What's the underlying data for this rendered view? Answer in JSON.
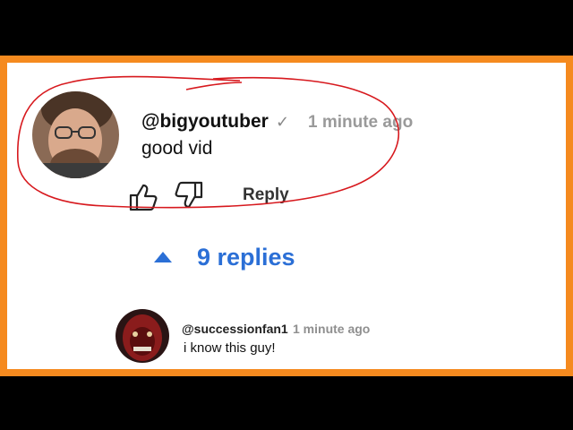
{
  "comment": {
    "username": "@bigyoutuber",
    "verified_icon": "✓",
    "timestamp": "1 minute ago",
    "text": "good vid",
    "like_icon": "thumbs-up-icon",
    "dislike_icon": "thumbs-down-icon",
    "reply_label": "Reply"
  },
  "replies_toggle": {
    "label": "9 replies",
    "icon": "caret-up-icon"
  },
  "first_reply": {
    "username": "@successionfan1",
    "timestamp": "1 minute ago",
    "text": "i know this guy!"
  },
  "colors": {
    "frame": "#f58a1f",
    "link_blue": "#2b6fd6",
    "annotation_red": "#d7191e"
  }
}
